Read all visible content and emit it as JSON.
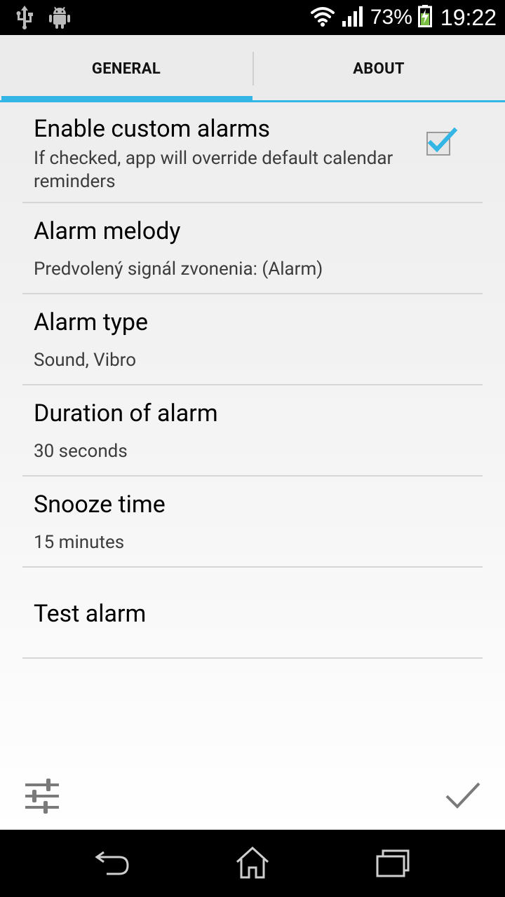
{
  "status_bar": {
    "battery_percent": "73%",
    "time": "19:22",
    "icons": [
      "usb-icon",
      "android-icon",
      "wifi-icon",
      "signal-icon",
      "battery-charging-icon"
    ]
  },
  "tabs": [
    {
      "label": "GENERAL",
      "selected": true
    },
    {
      "label": "ABOUT",
      "selected": false
    }
  ],
  "preferences": [
    {
      "title": "Enable custom alarms",
      "summary": "If checked, app will override default calendar reminders",
      "checked": true
    },
    {
      "title": "Alarm melody",
      "summary": "Predvolený signál zvonenia: (Alarm)"
    },
    {
      "title": "Alarm type",
      "summary": "Sound, Vibro"
    },
    {
      "title": "Duration of alarm",
      "summary": "30 seconds"
    },
    {
      "title": "Snooze time",
      "summary": "15 minutes"
    },
    {
      "title": "Test alarm",
      "summary": ""
    }
  ],
  "actions": {
    "left": "sliders-icon",
    "right": "check-icon"
  },
  "navigation": [
    "back-icon",
    "home-icon",
    "recent-apps-icon"
  ],
  "colors": {
    "accent": "#33b5e5",
    "title_text": "#000000",
    "summary_text": "#3c3c3c"
  }
}
